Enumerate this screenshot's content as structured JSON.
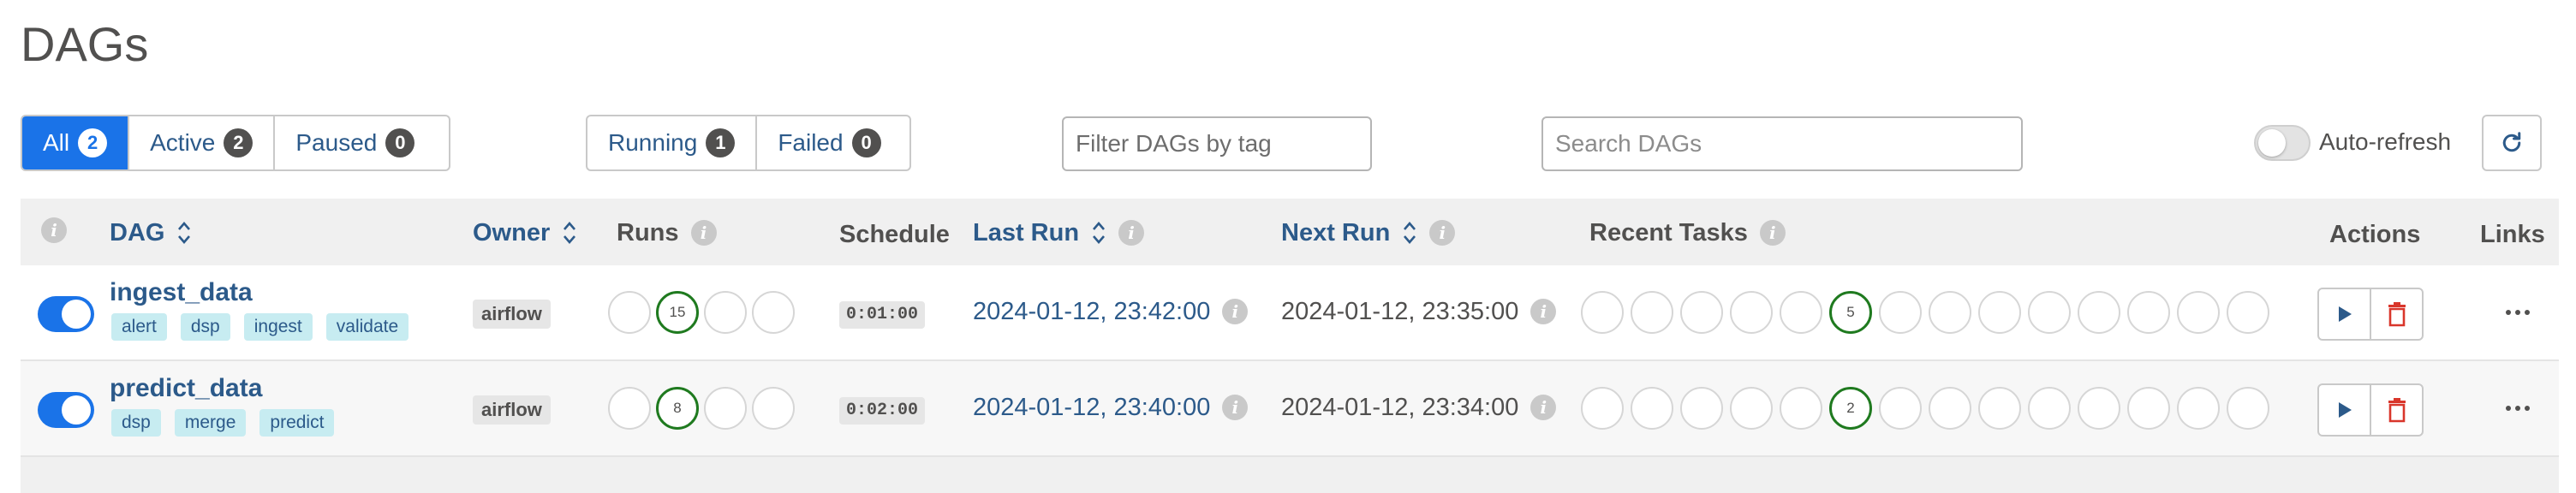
{
  "page": {
    "title": "DAGs"
  },
  "filters": {
    "status_group": [
      {
        "label": "All",
        "count": "2",
        "active": true
      },
      {
        "label": "Active",
        "count": "2",
        "active": false
      },
      {
        "label": "Paused",
        "count": "0",
        "active": false
      }
    ],
    "run_group": [
      {
        "label": "Running",
        "count": "1"
      },
      {
        "label": "Failed",
        "count": "0"
      }
    ],
    "tag_filter_placeholder": "Filter DAGs by tag",
    "search_placeholder": "Search DAGs",
    "auto_refresh_label": "Auto-refresh",
    "auto_refresh_on": false
  },
  "table": {
    "headers": {
      "dag": "DAG",
      "owner": "Owner",
      "runs": "Runs",
      "schedule": "Schedule",
      "last_run": "Last Run",
      "next_run": "Next Run",
      "recent_tasks": "Recent Tasks",
      "actions": "Actions",
      "links": "Links"
    },
    "rows": [
      {
        "name": "ingest_data",
        "enabled": true,
        "tags": [
          "alert",
          "dsp",
          "ingest",
          "validate"
        ],
        "owner": "airflow",
        "runs": [
          "",
          "15",
          "",
          ""
        ],
        "schedule": "0:01:00",
        "last_run": "2024-01-12, 23:42:00",
        "next_run": "2024-01-12, 23:35:00",
        "recent_tasks": [
          "",
          "",
          "",
          "",
          "",
          "5",
          "",
          "",
          "",
          "",
          "",
          "",
          "",
          ""
        ]
      },
      {
        "name": "predict_data",
        "enabled": true,
        "tags": [
          "dsp",
          "merge",
          "predict"
        ],
        "owner": "airflow",
        "runs": [
          "",
          "8",
          "",
          ""
        ],
        "schedule": "0:02:00",
        "last_run": "2024-01-12, 23:40:00",
        "next_run": "2024-01-12, 23:34:00",
        "recent_tasks": [
          "",
          "",
          "",
          "",
          "",
          "2",
          "",
          "",
          "",
          "",
          "",
          "",
          "",
          ""
        ]
      }
    ]
  },
  "colors": {
    "accent": "#1a73e8",
    "link": "#2c5a8a",
    "success": "#1f7a1f",
    "danger": "#d9362b"
  }
}
